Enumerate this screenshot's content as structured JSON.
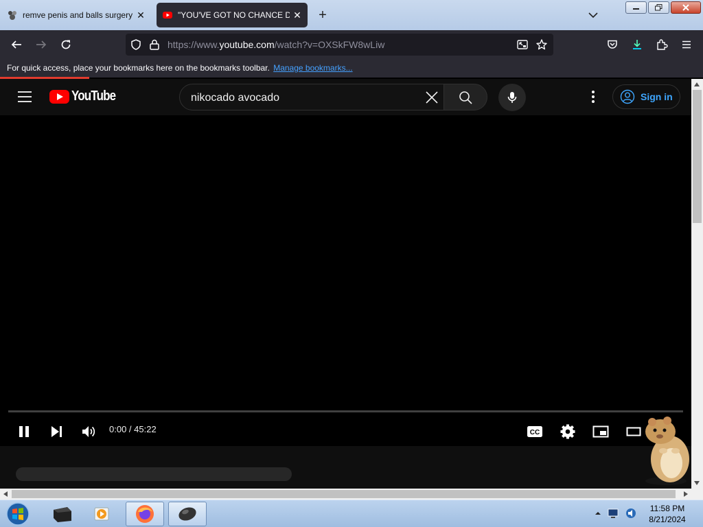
{
  "browser": {
    "tabs": [
      {
        "label": "remve penis and balls surgery (r",
        "close": "✕",
        "active": false
      },
      {
        "label": "\"YOU'VE GOT NO CHANCE DUR",
        "close": "✕",
        "active": true
      }
    ],
    "new_tab": "+",
    "url": {
      "prefix": "https://www.",
      "host": "youtube.com",
      "path": "/watch?v=OXSkFW8wLiw"
    },
    "bookmarks_text": "For quick access, place your bookmarks here on the bookmarks toolbar.",
    "bookmarks_link": "Manage bookmarks..."
  },
  "youtube": {
    "logo_text": "YouTube",
    "search_value": "nikocado avocado",
    "sign_in": "Sign in",
    "player": {
      "time": "0:00 / 45:22",
      "progress": 0
    }
  },
  "taskbar": {
    "clock_time": "11:58 PM",
    "clock_date": "8/21/2024"
  },
  "colors": {
    "youtube_red": "#ff0000",
    "link_blue": "#3ea6ff",
    "browser_dark": "#2b2a33"
  }
}
